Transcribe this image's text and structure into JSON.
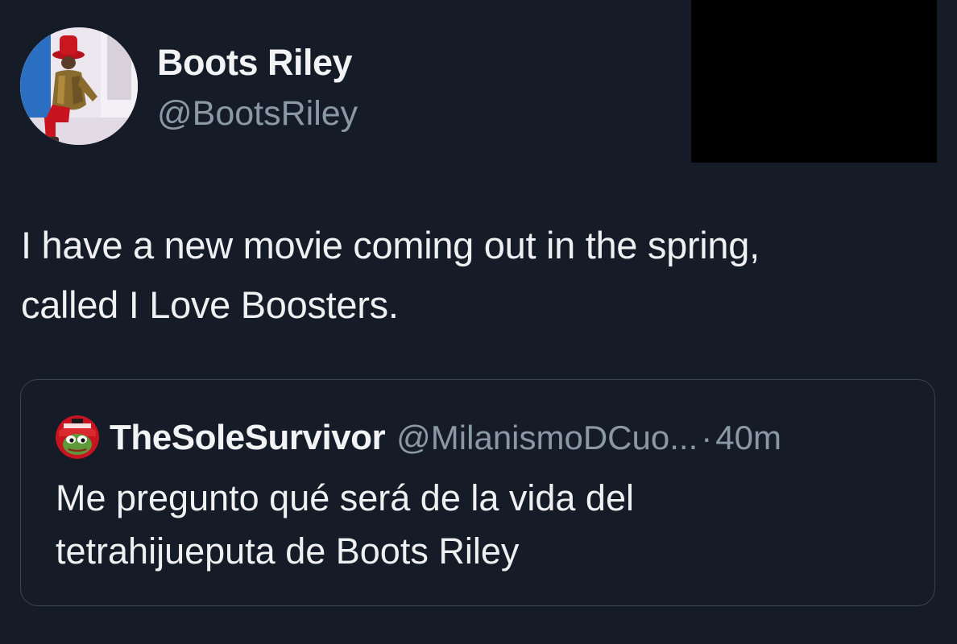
{
  "tweet": {
    "author": {
      "name": "Boots Riley",
      "handle": "@BootsRiley"
    },
    "text_lines": [
      "I have a new movie coming out in the spring,",
      "called I Love Boosters."
    ],
    "quoted": {
      "author": {
        "name": "TheSoleSurvivor",
        "handle": "@MilanismoDCuo...",
        "separator": "·",
        "time": "40m"
      },
      "text_lines": [
        "Me pregunto qué será de la vida del",
        "tetrahijueputa de Boots Riley"
      ]
    }
  },
  "colors": {
    "background": "#161c27",
    "text_primary": "#eef0f2",
    "text_secondary": "#8b98a5",
    "border": "#3a4451",
    "redaction": "#000000"
  },
  "icons": {
    "author_avatar": "profile-photo",
    "quoted_avatar": "frog-avatar"
  }
}
